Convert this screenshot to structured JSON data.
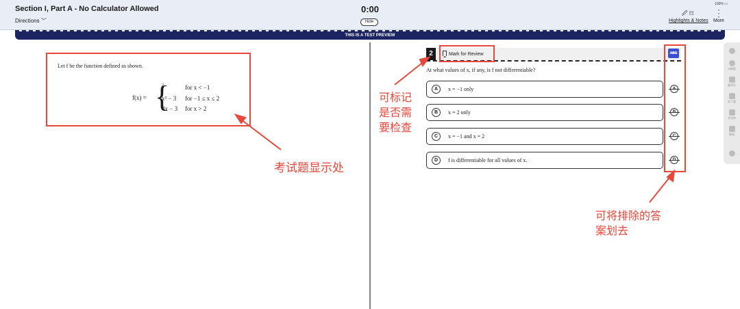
{
  "header": {
    "section_title": "Section I, Part A - No Calculator Allowed",
    "directions": "Directions ﹀",
    "timer": "0:00",
    "hide_label": "Hide",
    "battery": "100% ▭",
    "highlights_notes_icons": "🖉 ▤",
    "highlights_notes_label": "Highlights & Notes",
    "more_label": "More"
  },
  "banner": {
    "text": "THIS IS A TEST PREVIEW"
  },
  "stem": {
    "intro": "Let f be the function defined as shown.",
    "fx": "f(x) =",
    "rows": [
      {
        "expr_num": "2",
        "expr_den": "x",
        "cond": "for  x < −1"
      },
      {
        "expr": "x² − 3",
        "cond": "for  −1 ≤ x ≤ 2"
      },
      {
        "expr": "4x − 3",
        "cond": "for  x > 2"
      }
    ]
  },
  "question": {
    "number": "2",
    "mark_for_review": "Mark for Review",
    "abc_label": "ABC",
    "prompt": "At what values of x, if any, is f not differentiable?",
    "choices": [
      {
        "letter": "A",
        "text": "x = −1 only"
      },
      {
        "letter": "B",
        "text": "x = 2 only"
      },
      {
        "letter": "C",
        "text": "x = −1 and x = 2"
      },
      {
        "letter": "D",
        "text": "f is differentiable for all values of x."
      }
    ]
  },
  "annotations": {
    "stem_area": "考试题显示处",
    "mark_review": "可标记是否需要检查",
    "eliminate": "可将排除的答案划去"
  },
  "sidebar": {
    "items": [
      {
        "label": ""
      },
      {
        "label": "AI解题"
      },
      {
        "label": "翻译页"
      },
      {
        "label": "标个题"
      },
      {
        "label": "文档库"
      },
      {
        "label": "截图"
      },
      {
        "label": ""
      }
    ]
  },
  "colors": {
    "annotation_red": "#e8473a",
    "banner_navy": "#1c2561",
    "header_bg": "#e8edf6",
    "abc_blue": "#3b4fd6"
  }
}
